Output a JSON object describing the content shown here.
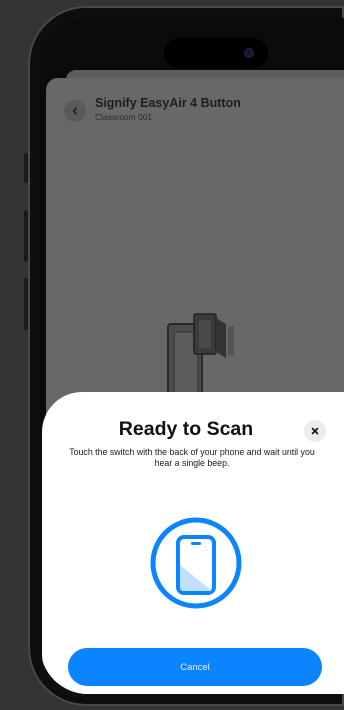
{
  "app_header": {
    "device_name": "Signify EasyAir 4 Button",
    "location": "Classroom 001"
  },
  "scan_sheet": {
    "title": "Ready to Scan",
    "instruction": "Touch the switch with the back of your phone and wait until you hear a single beep.",
    "cancel_label": "Cancel",
    "accent_color": "#0a84ff"
  },
  "icons": {
    "back": "chevron-left-icon",
    "close": "close-icon",
    "nfc": "phone-scan-icon",
    "device": "switch-illustration"
  }
}
